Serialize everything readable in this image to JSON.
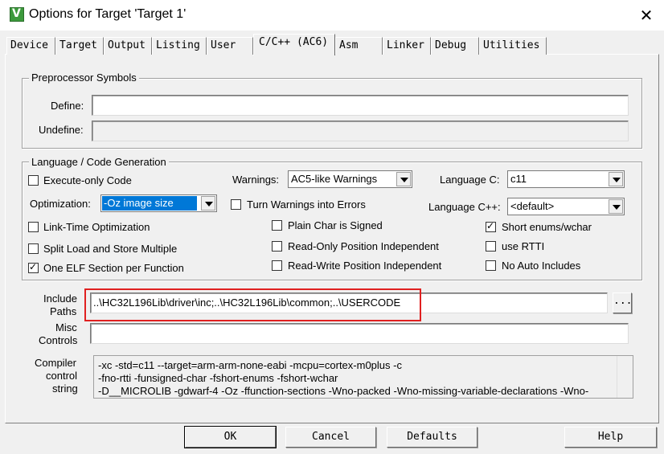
{
  "window": {
    "title": "Options for Target 'Target 1'",
    "close_glyph": "✕",
    "app_icon_letter": "V"
  },
  "tabs": [
    {
      "label": "Device"
    },
    {
      "label": "Target"
    },
    {
      "label": "Output"
    },
    {
      "label": "Listing"
    },
    {
      "label": "User"
    },
    {
      "label": "C/C++ (AC6)"
    },
    {
      "label": "Asm"
    },
    {
      "label": "Linker"
    },
    {
      "label": "Debug"
    },
    {
      "label": "Utilities"
    }
  ],
  "preprocessor": {
    "legend": "Preprocessor Symbols",
    "define_label": "Define:",
    "define_value": "",
    "undefine_label": "Undefine:",
    "undefine_value": ""
  },
  "language": {
    "legend": "Language / Code Generation",
    "execute_only": {
      "label": "Execute-only Code",
      "checked": false
    },
    "warnings_label": "Warnings:",
    "warnings_value": "AC5-like Warnings",
    "language_c_label": "Language C:",
    "language_c_value": "c11",
    "optimization_label": "Optimization:",
    "optimization_value": "-Oz image size",
    "turn_warnings_errors": {
      "label": "Turn Warnings into Errors",
      "checked": false
    },
    "language_cpp_label": "Language C++:",
    "language_cpp_value": "<default>",
    "link_time": {
      "label": "Link-Time Optimization",
      "checked": false
    },
    "plain_char": {
      "label": "Plain Char is Signed",
      "checked": false
    },
    "short_enums": {
      "label": "Short enums/wchar",
      "checked": true
    },
    "split_load": {
      "label": "Split Load and Store Multiple",
      "checked": false
    },
    "ro_pos_indep": {
      "label": "Read-Only Position Independent",
      "checked": false
    },
    "use_rtti": {
      "label": "use RTTI",
      "checked": false
    },
    "one_elf": {
      "label": "One ELF Section per Function",
      "checked": true
    },
    "rw_pos_indep": {
      "label": "Read-Write Position Independent",
      "checked": false
    },
    "no_auto_includes": {
      "label": "No Auto Includes",
      "checked": false
    }
  },
  "include": {
    "label_line1": "Include",
    "label_line2": "Paths",
    "value": "..\\HC32L196Lib\\driver\\inc;..\\HC32L196Lib\\common;..\\USERCODE",
    "browse_label": "..."
  },
  "misc": {
    "label_line1": "Misc",
    "label_line2": "Controls",
    "value": ""
  },
  "compiler": {
    "label_line1": "Compiler",
    "label_line2": "control",
    "label_line3": "string",
    "lines": [
      "-xc -std=c11 --target=arm-arm-none-eabi -mcpu=cortex-m0plus -c",
      "-fno-rtti -funsigned-char -fshort-enums -fshort-wchar",
      "-D__MICROLIB -gdwarf-4 -Oz -ffunction-sections -Wno-packed -Wno-missing-variable-declarations -Wno-"
    ]
  },
  "buttons": {
    "ok": "OK",
    "cancel": "Cancel",
    "defaults": "Defaults",
    "help": "Help"
  },
  "colors": {
    "highlight_box": "#e02020",
    "selection": "#0078d7"
  }
}
